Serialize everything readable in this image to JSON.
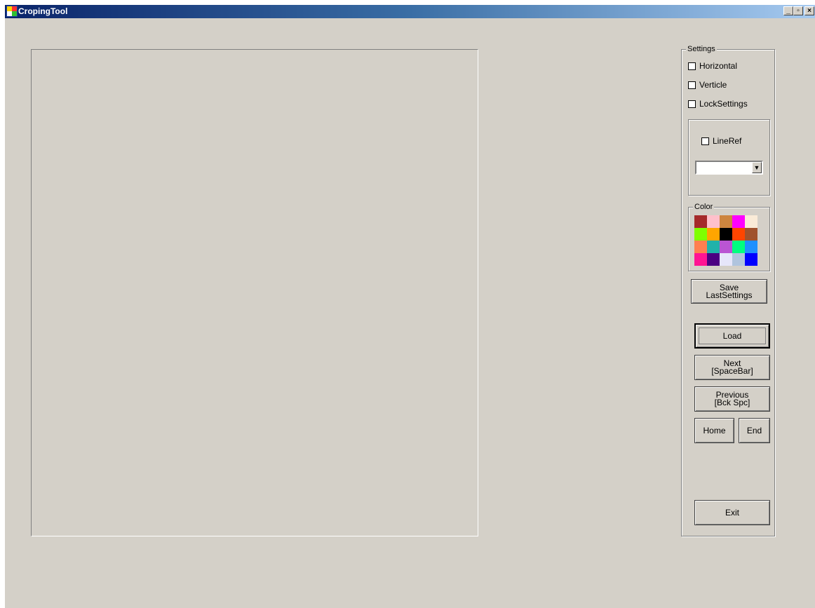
{
  "window": {
    "title": "CropingTool",
    "controls": {
      "minimize": "_",
      "maximize": "▫",
      "close": "×"
    }
  },
  "settings": {
    "legend": "Settings",
    "checkboxes": [
      {
        "label": "Horizontal",
        "checked": false
      },
      {
        "label": "Verticle",
        "checked": false
      },
      {
        "label": "LockSettings",
        "checked": false
      }
    ],
    "lineref": {
      "label": "LineRef",
      "checked": false,
      "dropdown_value": ""
    }
  },
  "color": {
    "legend": "Color",
    "swatches": [
      "#a52a2a",
      "#ffc0cb",
      "#cd853f",
      "#ff00ff",
      "#faebd7",
      "#7fff00",
      "#ffa500",
      "#000000",
      "#ff4500",
      "#a0522d",
      "#ff7f50",
      "#20b2aa",
      "#ba55d3",
      "#00ff7f",
      "#1e90ff",
      "#ff1493",
      "#4b0082",
      "#e6e6fa",
      "#b0c4de",
      "#0000ff"
    ]
  },
  "buttons": {
    "save": "Save\nLastSettings",
    "load": "Load",
    "next": "Next\n[SpaceBar]",
    "previous": "Previous\n[Bck Spc]",
    "home": "Home",
    "end": "End",
    "exit": "Exit"
  }
}
